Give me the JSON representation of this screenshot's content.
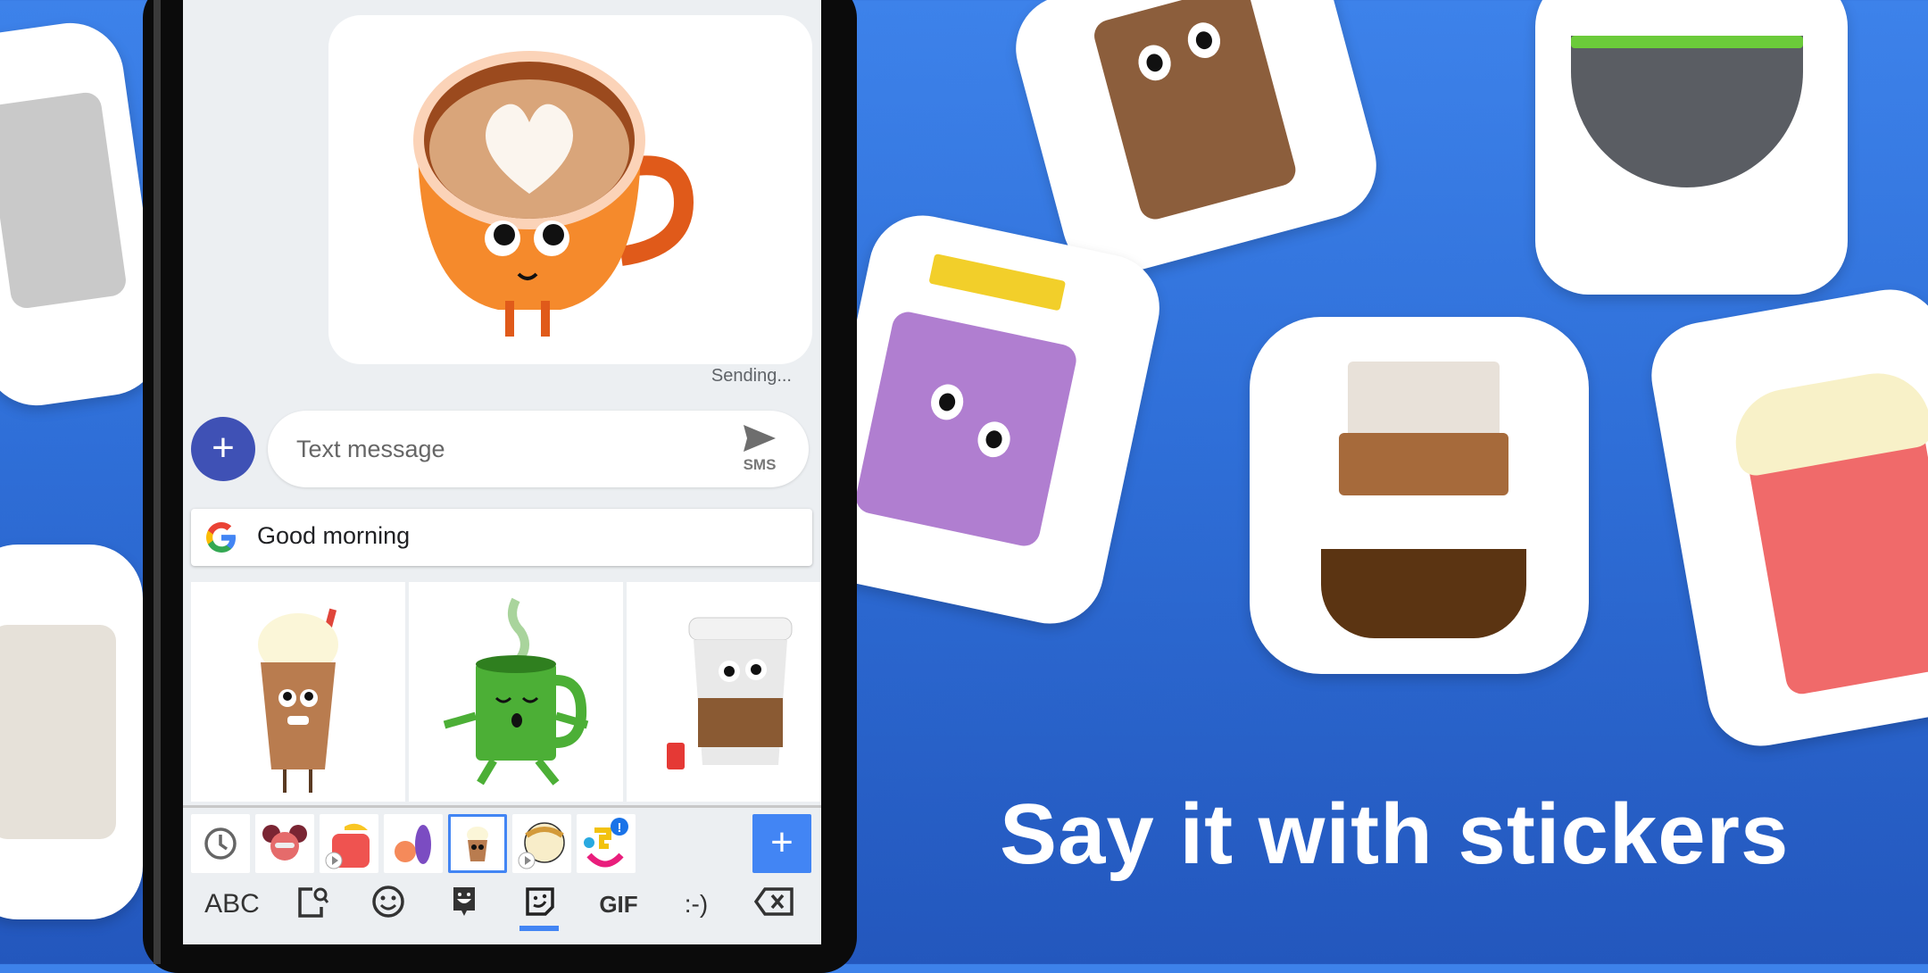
{
  "conversation": {
    "sent_sticker": "latte-heart-cup-sticker",
    "status": "Sending..."
  },
  "composer": {
    "placeholder": "Text message",
    "send_label": "SMS"
  },
  "suggestion": {
    "text": "Good morning"
  },
  "sticker_results": [
    {
      "name": "frappe-sticker"
    },
    {
      "name": "green-tea-mug-sticker"
    },
    {
      "name": "takeaway-coffee-sticker"
    }
  ],
  "sticker_tray": {
    "items": [
      {
        "name": "recent",
        "selected": false
      },
      {
        "name": "girl-pack",
        "selected": false
      },
      {
        "name": "dino-pack",
        "selected": false,
        "animated": true
      },
      {
        "name": "fruit-veg-pack",
        "selected": false
      },
      {
        "name": "coffee-pack",
        "selected": true
      },
      {
        "name": "bun-pack",
        "selected": false,
        "animated": true
      },
      {
        "name": "face-pack",
        "selected": false,
        "badge": "!"
      }
    ],
    "add_label": "+"
  },
  "keyboard_toolbar": {
    "abc": "ABC",
    "gif": "GIF",
    "emoticon": ":-)",
    "active_tab": "stickers"
  },
  "promo": {
    "tagline": "Say it with stickers"
  },
  "colors": {
    "background_top": "#3d82ea",
    "background_bottom": "#2357bd",
    "accent": "#4285f4",
    "fab": "#3f51b5"
  }
}
